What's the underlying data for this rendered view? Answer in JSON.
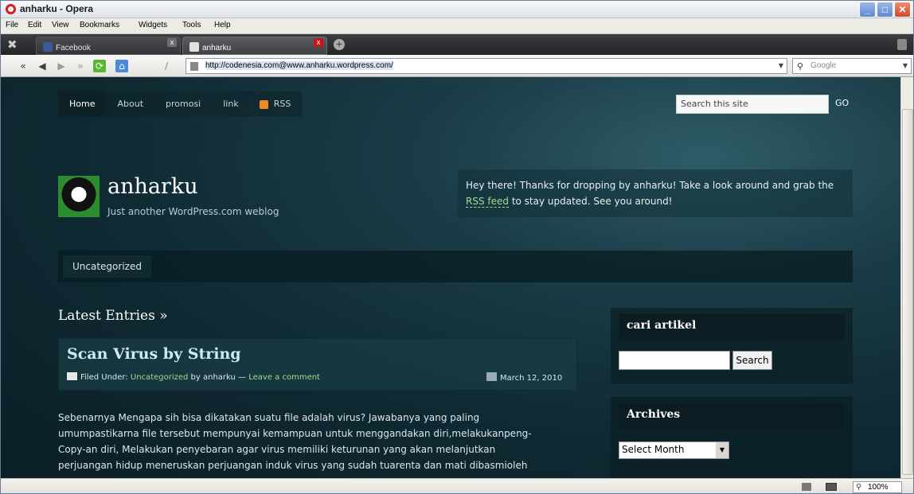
{
  "window": {
    "title": "anharku - Opera"
  },
  "menu": [
    "File",
    "Edit",
    "View",
    "Bookmarks",
    "Widgets",
    "Tools",
    "Help"
  ],
  "tabs": [
    {
      "label": "Facebook",
      "active": false
    },
    {
      "label": "anharku",
      "active": true
    }
  ],
  "address": {
    "url": "http://codenesia.com@www.anharku.wordpress.com/",
    "search_placeholder": "Google"
  },
  "status": {
    "zoom": "100%"
  },
  "site": {
    "nav": [
      "Home",
      "About",
      "promosi",
      "link",
      "RSS"
    ],
    "search_placeholder": "Search this site",
    "go": "GO",
    "title": "anharku",
    "tagline": "Just another WordPress.com weblog",
    "welcome_pre": "Hey there! Thanks for dropping by anharku! Take a look around and grab the ",
    "welcome_link": "RSS feed",
    "welcome_post": " to stay updated. See you around!",
    "category": "Uncategorized",
    "latest": "Latest Entries »"
  },
  "post": {
    "title": "Scan Virus by String",
    "filed_under": "Filed Under: ",
    "category": "Uncategorized",
    "by": " by anharku — ",
    "comment": "Leave a comment",
    "date": "March 12, 2010",
    "lines": [
      "Sebenarnya Mengapa sih bisa dikatakan suatu file adalah virus? Jawabanya yang paling",
      "umumpastikarna file tersebut mempunyai kemampuan untuk menggandakan diri,melakukanpeng-",
      "Copy-an diri, Melakukan penyebaran agar virus memiliki keturunan yang akan melanjutkan",
      "perjuangan hidup meneruskan perjuangan induk virus yang sudah tuarenta dan mati dibasmioleh"
    ]
  },
  "sidebar": {
    "search_title": "cari artikel",
    "search_btn": "Search",
    "archives_title": "Archives",
    "archives_select": "Select Month"
  }
}
